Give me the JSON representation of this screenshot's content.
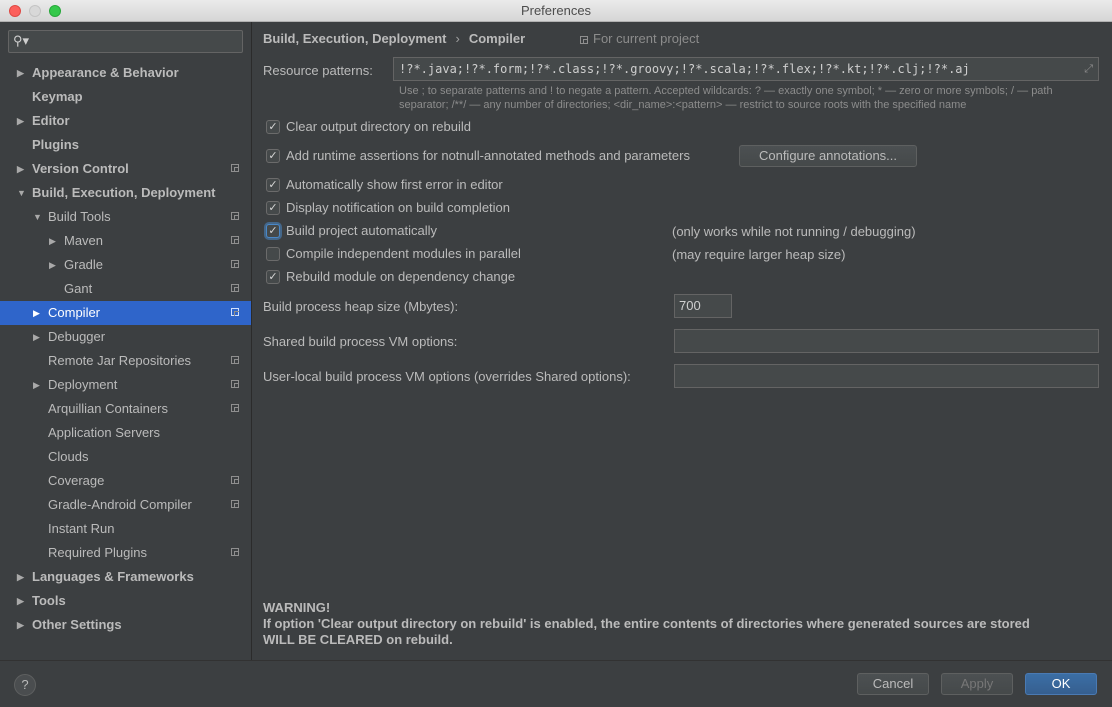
{
  "window": {
    "title": "Preferences"
  },
  "sidebar": {
    "search_placeholder": "",
    "items": [
      {
        "label": "Appearance & Behavior",
        "bold": true,
        "level": 0,
        "arrow": "right",
        "project": false
      },
      {
        "label": "Keymap",
        "bold": true,
        "level": 0,
        "arrow": "none",
        "project": false
      },
      {
        "label": "Editor",
        "bold": true,
        "level": 0,
        "arrow": "right",
        "project": false
      },
      {
        "label": "Plugins",
        "bold": true,
        "level": 0,
        "arrow": "none",
        "project": false
      },
      {
        "label": "Version Control",
        "bold": true,
        "level": 0,
        "arrow": "right",
        "project": true
      },
      {
        "label": "Build, Execution, Deployment",
        "bold": true,
        "level": 0,
        "arrow": "down",
        "project": false
      },
      {
        "label": "Build Tools",
        "bold": false,
        "level": 1,
        "arrow": "down",
        "project": true
      },
      {
        "label": "Maven",
        "bold": false,
        "level": 2,
        "arrow": "right",
        "project": true
      },
      {
        "label": "Gradle",
        "bold": false,
        "level": 2,
        "arrow": "right",
        "project": true
      },
      {
        "label": "Gant",
        "bold": false,
        "level": 2,
        "arrow": "none",
        "project": true
      },
      {
        "label": "Compiler",
        "bold": false,
        "level": 1,
        "arrow": "right",
        "project": true,
        "selected": true
      },
      {
        "label": "Debugger",
        "bold": false,
        "level": 1,
        "arrow": "right",
        "project": false
      },
      {
        "label": "Remote Jar Repositories",
        "bold": false,
        "level": 1,
        "arrow": "none",
        "project": true
      },
      {
        "label": "Deployment",
        "bold": false,
        "level": 1,
        "arrow": "right",
        "project": true
      },
      {
        "label": "Arquillian Containers",
        "bold": false,
        "level": 1,
        "arrow": "none",
        "project": true
      },
      {
        "label": "Application Servers",
        "bold": false,
        "level": 1,
        "arrow": "none",
        "project": false
      },
      {
        "label": "Clouds",
        "bold": false,
        "level": 1,
        "arrow": "none",
        "project": false
      },
      {
        "label": "Coverage",
        "bold": false,
        "level": 1,
        "arrow": "none",
        "project": true
      },
      {
        "label": "Gradle-Android Compiler",
        "bold": false,
        "level": 1,
        "arrow": "none",
        "project": true
      },
      {
        "label": "Instant Run",
        "bold": false,
        "level": 1,
        "arrow": "none",
        "project": false
      },
      {
        "label": "Required Plugins",
        "bold": false,
        "level": 1,
        "arrow": "none",
        "project": true
      },
      {
        "label": "Languages & Frameworks",
        "bold": true,
        "level": 0,
        "arrow": "right",
        "project": false
      },
      {
        "label": "Tools",
        "bold": true,
        "level": 0,
        "arrow": "right",
        "project": false
      },
      {
        "label": "Other Settings",
        "bold": true,
        "level": 0,
        "arrow": "right",
        "project": false
      }
    ]
  },
  "breadcrumb": {
    "parent": "Build, Execution, Deployment",
    "separator": "›",
    "current": "Compiler",
    "scope": "For current project"
  },
  "compiler": {
    "resource_patterns_label": "Resource patterns:",
    "resource_patterns_value": "!?*.java;!?*.form;!?*.class;!?*.groovy;!?*.scala;!?*.flex;!?*.kt;!?*.clj;!?*.aj",
    "hint_line1": "Use ; to separate patterns and ! to negate a pattern. Accepted wildcards: ? — exactly one symbol; * — zero or more symbols; / — path",
    "hint_line2": "separator; /**/ — any number of directories; <dir_name>:<pattern> — restrict to source roots with the specified name",
    "checkboxes": {
      "clear_output": {
        "label": "Clear output directory on rebuild",
        "checked": true
      },
      "runtime_assertions": {
        "label": "Add runtime assertions for notnull-annotated methods and parameters",
        "checked": true
      },
      "show_first_error": {
        "label": "Automatically show first error in editor",
        "checked": true
      },
      "notify_completion": {
        "label": "Display notification on build completion",
        "checked": true
      },
      "build_auto": {
        "label": "Build project automatically",
        "checked": true,
        "note": "(only works while not running / debugging)"
      },
      "parallel": {
        "label": "Compile independent modules in parallel",
        "checked": false,
        "note": "(may require larger heap size)"
      },
      "rebuild_dep": {
        "label": "Rebuild module on dependency change",
        "checked": true
      }
    },
    "configure_annotations_label": "Configure annotations...",
    "heap_label": "Build process heap size (Mbytes):",
    "heap_value": "700",
    "shared_vm_label": "Shared build process VM options:",
    "shared_vm_value": "",
    "local_vm_label": "User-local build process VM options (overrides Shared options):",
    "local_vm_value": "",
    "warning_title": "WARNING!",
    "warning_line1": "If option 'Clear output directory on rebuild' is enabled, the entire contents of directories where generated sources are stored",
    "warning_line2": "WILL BE CLEARED on rebuild."
  },
  "footer": {
    "help_label": "?",
    "cancel_label": "Cancel",
    "apply_label": "Apply",
    "ok_label": "OK"
  },
  "icons": {
    "check": "✓",
    "search": "⚲",
    "arrow_right": "▶",
    "arrow_down": "▼",
    "expand": "⤢"
  }
}
